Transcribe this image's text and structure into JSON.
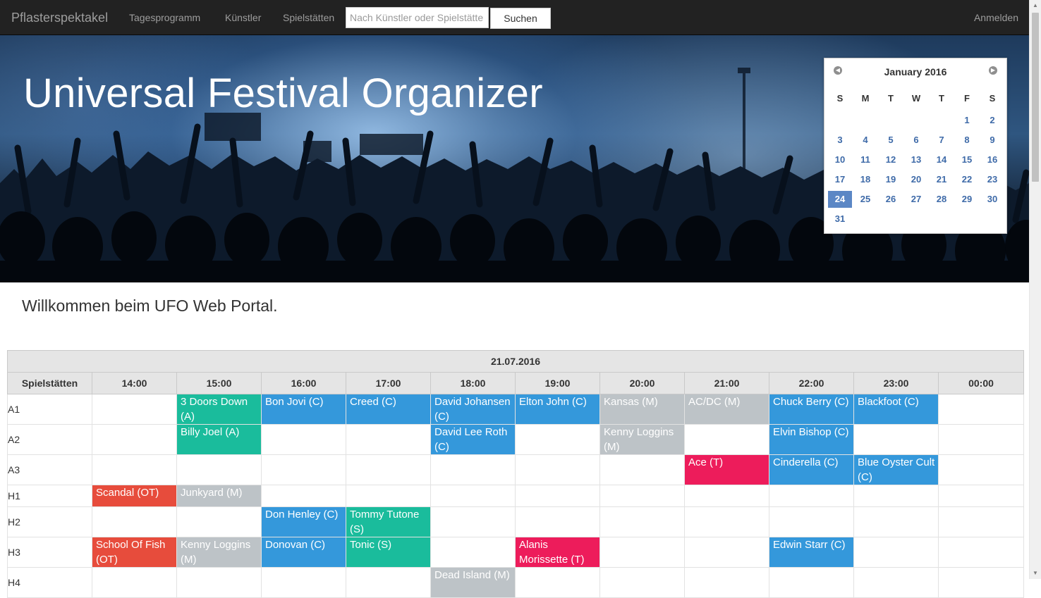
{
  "navbar": {
    "brand": "Pflasterspektakel",
    "links": [
      "Tagesprogramm",
      "Künstler",
      "Spielstätten"
    ],
    "search_placeholder": "Nach Künstler oder Spielstätte suchen",
    "search_button": "Suchen",
    "login": "Anmelden",
    "background": "#222222"
  },
  "hero": {
    "title": "Universal Festival Organizer"
  },
  "calendar": {
    "title": "January 2016",
    "prev_icon": "chevron-left-icon",
    "next_icon": "chevron-right-icon",
    "weekdays": [
      "S",
      "M",
      "T",
      "W",
      "T",
      "F",
      "S"
    ],
    "weeks": [
      [
        "",
        "",
        "",
        "",
        "",
        "1",
        "2"
      ],
      [
        "3",
        "4",
        "5",
        "6",
        "7",
        "8",
        "9"
      ],
      [
        "10",
        "11",
        "12",
        "13",
        "14",
        "15",
        "16"
      ],
      [
        "17",
        "18",
        "19",
        "20",
        "21",
        "22",
        "23"
      ],
      [
        "24",
        "25",
        "26",
        "27",
        "28",
        "29",
        "30"
      ],
      [
        "31",
        "",
        "",
        "",
        "",
        "",
        ""
      ]
    ],
    "selected_day": "24",
    "selected_color": "#5b87c5",
    "day_color": "#3e6aa8"
  },
  "welcome": "Willkommen beim UFO Web Portal.",
  "schedule": {
    "date": "21.07.2016",
    "venue_header": "Spielstätten",
    "times": [
      "14:00",
      "15:00",
      "16:00",
      "17:00",
      "18:00",
      "19:00",
      "20:00",
      "21:00",
      "22:00",
      "23:00",
      "00:00"
    ],
    "category_colors": {
      "C": "#3498db",
      "A": "#1abc9c",
      "S": "#1abc9c",
      "M": "#bdc3c7",
      "T": "#ed1c5b",
      "OT": "#e74c3c"
    },
    "rows": [
      {
        "venue": "A1",
        "short": false,
        "cells": [
          null,
          {
            "label": "3 Doors Down (A)",
            "cat": "A"
          },
          {
            "label": "Bon Jovi (C)",
            "cat": "C"
          },
          {
            "label": "Creed (C)",
            "cat": "C"
          },
          {
            "label": "David Johansen (C)",
            "cat": "C"
          },
          {
            "label": "Elton John (C)",
            "cat": "C"
          },
          {
            "label": "Kansas (M)",
            "cat": "M"
          },
          {
            "label": "AC/DC (M)",
            "cat": "M"
          },
          {
            "label": "Chuck Berry (C)",
            "cat": "C"
          },
          {
            "label": "Blackfoot (C)",
            "cat": "C"
          },
          null
        ]
      },
      {
        "venue": "A2",
        "short": false,
        "cells": [
          null,
          {
            "label": "Billy Joel (A)",
            "cat": "A"
          },
          null,
          null,
          {
            "label": "David Lee Roth (C)",
            "cat": "C"
          },
          null,
          {
            "label": "Kenny Loggins (M)",
            "cat": "M"
          },
          null,
          {
            "label": "Elvin Bishop (C)",
            "cat": "C"
          },
          null,
          null
        ]
      },
      {
        "venue": "A3",
        "short": false,
        "cells": [
          null,
          null,
          null,
          null,
          null,
          null,
          null,
          {
            "label": "Ace (T)",
            "cat": "T"
          },
          {
            "label": "Cinderella (C)",
            "cat": "C"
          },
          {
            "label": "Blue Oyster Cult (C)",
            "cat": "C"
          },
          null
        ]
      },
      {
        "venue": "H1",
        "short": true,
        "cells": [
          {
            "label": "Scandal (OT)",
            "cat": "OT"
          },
          {
            "label": "Junkyard (M)",
            "cat": "M"
          },
          null,
          null,
          null,
          null,
          null,
          null,
          null,
          null,
          null
        ]
      },
      {
        "venue": "H2",
        "short": false,
        "cells": [
          null,
          null,
          {
            "label": "Don Henley (C)",
            "cat": "C"
          },
          {
            "label": "Tommy Tutone (S)",
            "cat": "S"
          },
          null,
          null,
          null,
          null,
          null,
          null,
          null
        ]
      },
      {
        "venue": "H3",
        "short": false,
        "cells": [
          {
            "label": "School Of Fish (OT)",
            "cat": "OT"
          },
          {
            "label": "Kenny Loggins (M)",
            "cat": "M"
          },
          {
            "label": "Donovan (C)",
            "cat": "C"
          },
          {
            "label": "Tonic (S)",
            "cat": "S"
          },
          null,
          {
            "label": "Alanis Morissette (T)",
            "cat": "T"
          },
          null,
          null,
          {
            "label": "Edwin Starr (C)",
            "cat": "C"
          },
          null,
          null
        ]
      },
      {
        "venue": "H4",
        "short": false,
        "cells": [
          null,
          null,
          null,
          null,
          {
            "label": "Dead Island (M)",
            "cat": "M"
          },
          null,
          null,
          null,
          null,
          null,
          null
        ]
      }
    ]
  }
}
